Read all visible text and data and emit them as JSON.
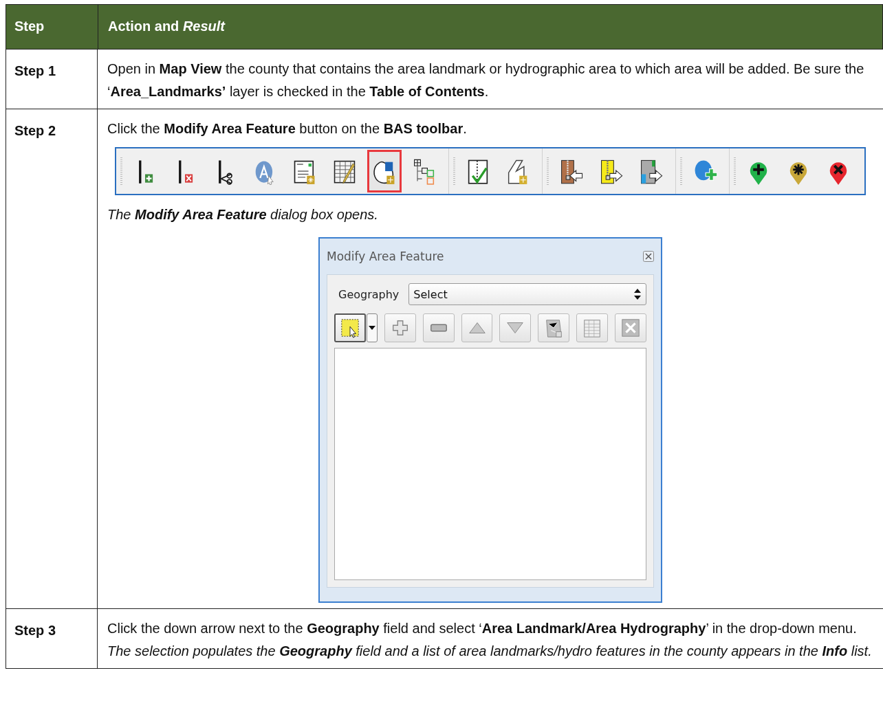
{
  "table": {
    "columns": [
      "Step",
      "Action and *Result*"
    ],
    "rows": [
      {
        "step": "Step 1",
        "action": "Open in **Map View** the county that contains the area landmark or hydrographic area to which area will be added. Be sure the ‘**Area_Landmarks’** layer is checked in the **Table of Contents**."
      },
      {
        "step": "Step 2",
        "action": "Click the **Modify Area Feature** button on the **BAS toolbar**.",
        "toolbar": {
          "groups": [
            {
              "tools": [
                {
                  "kind": "add-line",
                  "selected": false
                },
                {
                  "kind": "delete-line",
                  "selected": false
                },
                {
                  "kind": "cut-line",
                  "selected": false
                },
                {
                  "kind": "label",
                  "selected": false
                },
                {
                  "kind": "form-new",
                  "selected": false
                },
                {
                  "kind": "table-edit",
                  "selected": false
                },
                {
                  "kind": "area-modify",
                  "selected": true
                },
                {
                  "kind": "tree",
                  "selected": false
                }
              ]
            },
            {
              "tools": [
                {
                  "kind": "check-line",
                  "selected": false
                },
                {
                  "kind": "polygon-new",
                  "selected": false
                }
              ]
            },
            {
              "tools": [
                {
                  "kind": "zip-brown",
                  "selected": false
                },
                {
                  "kind": "zip-yellow",
                  "selected": false
                },
                {
                  "kind": "map-export",
                  "selected": false
                }
              ]
            },
            {
              "tools": [
                {
                  "kind": "globe-add",
                  "selected": false
                }
              ]
            },
            {
              "tools": [
                {
                  "kind": "pin-add",
                  "selected": false
                },
                {
                  "kind": "pin-star",
                  "selected": false
                },
                {
                  "kind": "pin-remove",
                  "selected": false
                }
              ]
            }
          ]
        },
        "result": "The **Modify Area Feature** dialog box opens.",
        "dialog": {
          "title": "Modify Area Feature",
          "field_label": "Geography",
          "field_value": "Select",
          "buttons": [
            {
              "kind": "select"
            },
            {
              "kind": "add"
            },
            {
              "kind": "remove"
            },
            {
              "kind": "up"
            },
            {
              "kind": "down"
            },
            {
              "kind": "map"
            },
            {
              "kind": "table"
            },
            {
              "kind": "close"
            }
          ]
        }
      },
      {
        "step": "Step 3",
        "action": "Click the down arrow next to the **Geography** field and select ‘**Area Landmark/Area Hydrography**’ in the drop-down menu.",
        "action_result": "The selection populates the **Geography** field and a list of area landmarks/hydro features in the county appears in the **Info** list."
      }
    ]
  }
}
